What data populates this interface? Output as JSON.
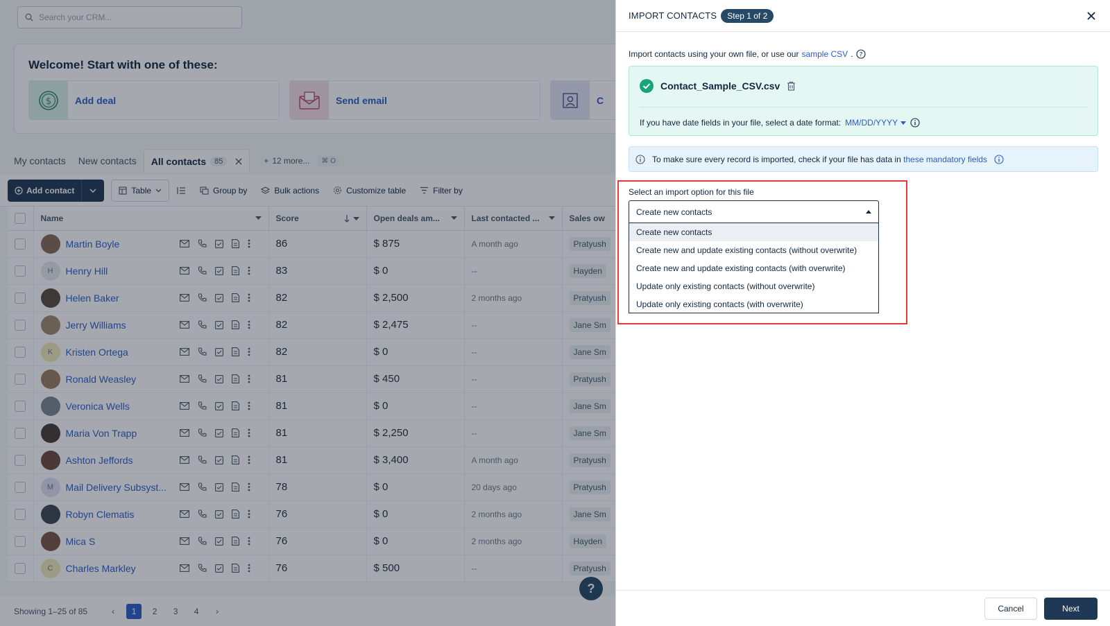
{
  "search": {
    "placeholder": "Search your CRM..."
  },
  "welcome": {
    "title": "Welcome! Start with one of these:",
    "cards": [
      {
        "label": "Add deal",
        "icon": "dollar-icon"
      },
      {
        "label": "Send email",
        "icon": "email-icon"
      },
      {
        "label": "C",
        "icon": "contact-frame-icon"
      }
    ]
  },
  "views": {
    "tabs": [
      "My contacts",
      "New contacts",
      "All contacts"
    ],
    "active_count": "85",
    "more": "12 more...",
    "shortcut": "⌘ O"
  },
  "toolbar": {
    "add_contact": "Add contact",
    "table": "Table",
    "group_by": "Group by",
    "bulk_actions": "Bulk actions",
    "customize": "Customize table",
    "filter": "Filter by"
  },
  "columns": {
    "name": "Name",
    "score": "Score",
    "open_deals": "Open deals am...",
    "last_contacted": "Last contacted ...",
    "sales_owner": "Sales ow"
  },
  "rows": [
    {
      "name": "Martin Boyle",
      "score": "86",
      "deals": "$ 875",
      "last": "A month ago",
      "owner": "Pratyush"
    },
    {
      "name": "Henry Hill",
      "initial": "H",
      "score": "83",
      "deals": "$ 0",
      "last": "--",
      "owner": "Hayden"
    },
    {
      "name": "Helen Baker",
      "score": "82",
      "deals": "$ 2,500",
      "last": "2 months ago",
      "owner": "Pratyush"
    },
    {
      "name": "Jerry Williams",
      "score": "82",
      "deals": "$ 2,475",
      "last": "--",
      "owner": "Jane Sm"
    },
    {
      "name": "Kristen Ortega",
      "initial": "K",
      "score": "82",
      "deals": "$ 0",
      "last": "--",
      "owner": "Jane Sm"
    },
    {
      "name": "Ronald Weasley",
      "score": "81",
      "deals": "$ 450",
      "last": "--",
      "owner": "Pratyush"
    },
    {
      "name": "Veronica Wells",
      "score": "81",
      "deals": "$ 0",
      "last": "--",
      "owner": "Jane Sm"
    },
    {
      "name": "Maria Von Trapp",
      "score": "81",
      "deals": "$ 2,250",
      "last": "--",
      "owner": "Jane Sm"
    },
    {
      "name": "Ashton Jeffords",
      "score": "81",
      "deals": "$ 3,400",
      "last": "A month ago",
      "owner": "Pratyush"
    },
    {
      "name": "Mail Delivery Subsyst...",
      "initial": "M",
      "score": "78",
      "deals": "$ 0",
      "last": "20 days ago",
      "owner": "Pratyush"
    },
    {
      "name": "Robyn Clematis",
      "score": "76",
      "deals": "$ 0",
      "last": "2 months ago",
      "owner": "Jane Sm"
    },
    {
      "name": "Mica S",
      "score": "76",
      "deals": "$ 0",
      "last": "2 months ago",
      "owner": "Hayden"
    },
    {
      "name": "Charles Markley",
      "initial": "C",
      "score": "76",
      "deals": "$ 500",
      "last": "--",
      "owner": "Pratyush"
    }
  ],
  "pager": {
    "showing": "Showing 1–25 of 85",
    "pages": [
      "1",
      "2",
      "3",
      "4"
    ]
  },
  "panel": {
    "title": "IMPORT CONTACTS",
    "step": "Step 1 of 2",
    "intro": "Import contacts using your own file, or use our",
    "sample_link": "sample CSV",
    "file_name": "Contact_Sample_CSV.csv",
    "date_text": "If you have date fields in your file, select a date format:",
    "date_value": "MM/DD/YYYY",
    "info_text": "To make sure every record is imported, check if your file has data in",
    "info_link": "these mandatory fields",
    "select_label": "Select an import option for this file",
    "select_value": "Create new contacts",
    "options": [
      "Create new contacts",
      "Create new and update existing contacts (without overwrite)",
      "Create new and update existing contacts (with overwrite)",
      "Update only existing contacts (without overwrite)",
      "Update only existing contacts (with overwrite)"
    ],
    "cancel": "Cancel",
    "next": "Next"
  }
}
